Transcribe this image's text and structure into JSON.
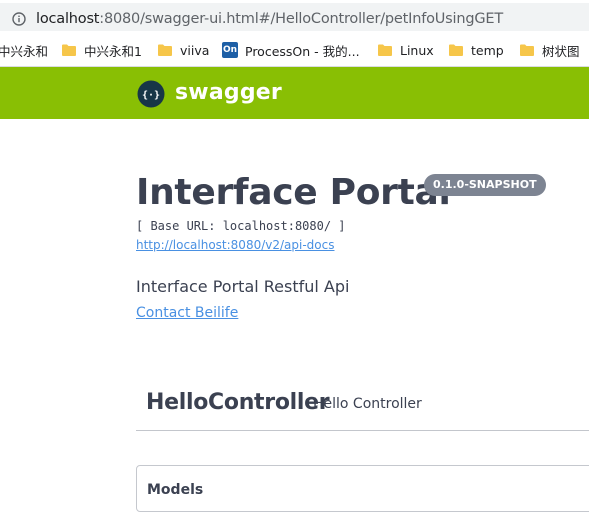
{
  "browser": {
    "url_host": "localhost",
    "url_rest": ":8080/swagger-ui.html#/HelloController/petInfoUsingGET",
    "bookmarks": [
      {
        "label": "中兴永和",
        "icon": "none"
      },
      {
        "label": "中兴永和1",
        "icon": "folder-icon"
      },
      {
        "label": "viiva",
        "icon": "folder-icon"
      },
      {
        "label": "ProcessOn - 我的...",
        "icon": "processon-icon"
      },
      {
        "label": "Linux",
        "icon": "folder-icon"
      },
      {
        "label": "temp",
        "icon": "folder-icon"
      },
      {
        "label": "树状图",
        "icon": "folder-icon"
      }
    ],
    "processon_icon_text": "On"
  },
  "swagger": {
    "logo_text": "swagger",
    "logo_symbol": "{···}"
  },
  "info": {
    "title": "Interface Portal",
    "version": "0.1.0-SNAPSHOT",
    "base_url": "[ Base URL: localhost:8080/ ]",
    "api_docs_link": "http://localhost:8080/v2/api-docs",
    "description": "Interface Portal Restful Api",
    "contact": "Contact Beilife"
  },
  "tags": [
    {
      "name": "HelloController",
      "description": "Hello Controller"
    }
  ],
  "models": {
    "label": "Models"
  },
  "colors": {
    "topbar": "#89bf04",
    "text": "#3b4151",
    "link": "#4990e2",
    "version_badge": "#7d8492"
  }
}
